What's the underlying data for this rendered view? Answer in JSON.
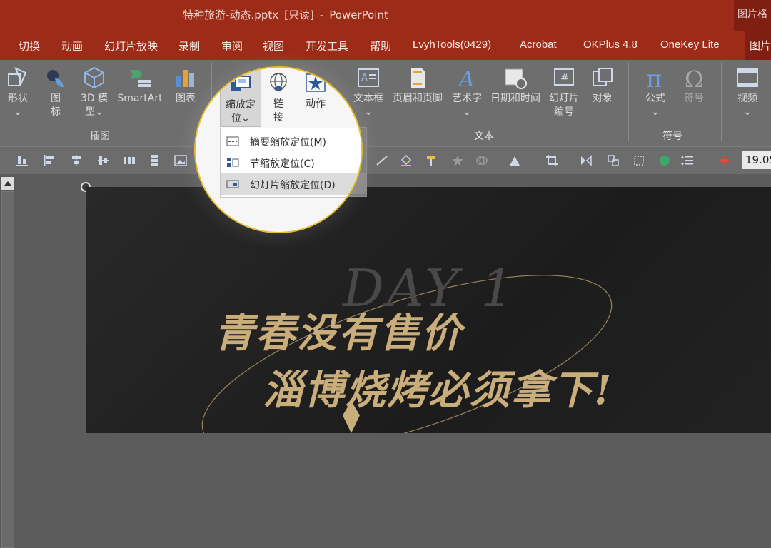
{
  "titlebar": {
    "filename": "特种旅游-动态.pptx",
    "readonly": "[只读]",
    "dash": "-",
    "app": "PowerPoint",
    "picture_tab": "图片格式"
  },
  "menu": {
    "tabs": [
      "切换",
      "动画",
      "幻灯片放映",
      "录制",
      "审阅",
      "视图",
      "开发工具",
      "帮助",
      "LvyhTools(0429)",
      "Acrobat",
      "OKPlus 4.8",
      "OneKey Lite"
    ],
    "picture_tab": "图片格式"
  },
  "ribbon": {
    "shapes": "形状",
    "icons_top": "图",
    "icons_bottom": "标",
    "model3d_top": "3D 模",
    "model3d_bottom": "型",
    "smartart": "SmartArt",
    "chart": "图表",
    "group_illustrations": "插图",
    "zoom_top": "缩放定",
    "zoom_bottom": "位",
    "link_top": "链",
    "link_bottom": "接",
    "action": "动作",
    "textbox": "文本框",
    "header_footer": "页眉和页脚",
    "wordart": "艺术字",
    "datetime": "日期和时间",
    "slide_number_top": "幻灯片",
    "slide_number_bottom": "编号",
    "object": "对象",
    "group_text": "文本",
    "equation": "公式",
    "symbol": "符号",
    "group_symbols": "符号",
    "video": "视频",
    "chevron": "⌄"
  },
  "dropdown": {
    "items": [
      {
        "label": "摘要缩放定位(M)"
      },
      {
        "label": "节缩放定位(C)"
      },
      {
        "label": "幻灯片缩放定位(D)"
      }
    ]
  },
  "toolbar": {
    "zoom_value": "19.05"
  },
  "slide": {
    "title_bg": "DAY 1",
    "line1": "青春没有售价",
    "line2": "淄博烧烤必须拿下!"
  },
  "colors": {
    "titlebar": "#9c2b18",
    "ribbon": "#6e6e6e",
    "spotlight_ring": "#e6bd2d",
    "slide_text_gold": "#c9ad7a"
  }
}
